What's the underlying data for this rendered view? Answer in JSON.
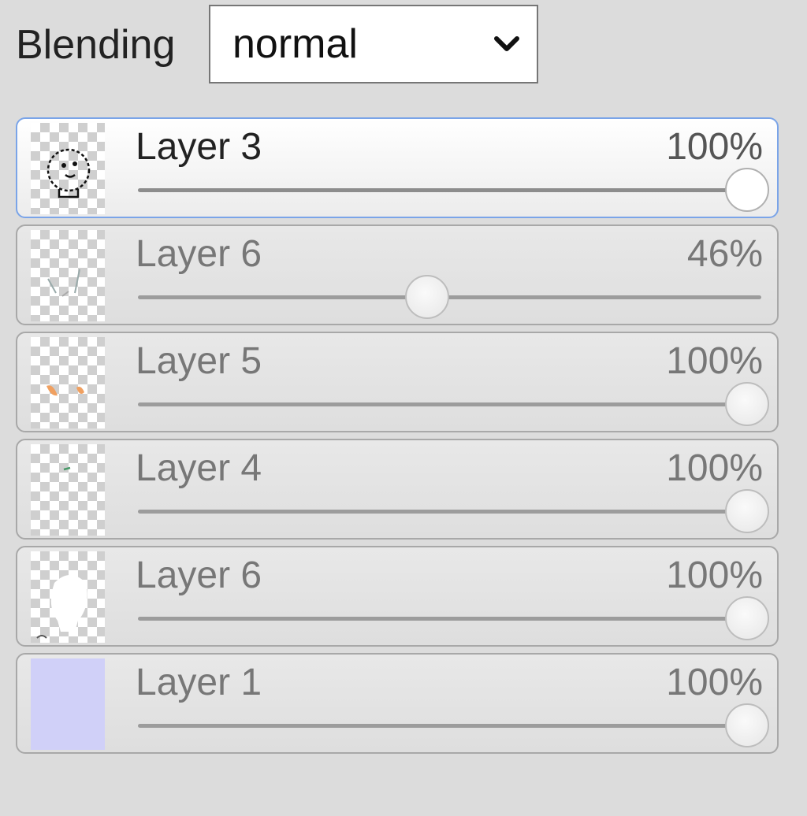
{
  "blending": {
    "label": "Blending",
    "selected": "normal"
  },
  "layers": [
    {
      "name": "Layer 3",
      "opacity": 100,
      "opacity_text": "100%",
      "thumb": "sketch-face-outline",
      "active": true
    },
    {
      "name": "Layer 6",
      "opacity": 46,
      "opacity_text": "46%",
      "thumb": "faint-strokes",
      "active": false
    },
    {
      "name": "Layer 5",
      "opacity": 100,
      "opacity_text": "100%",
      "thumb": "orange-marks",
      "active": false
    },
    {
      "name": "Layer 4",
      "opacity": 100,
      "opacity_text": "100%",
      "thumb": "green-mark",
      "active": false
    },
    {
      "name": "Layer 6",
      "opacity": 100,
      "opacity_text": "100%",
      "thumb": "white-shape",
      "active": false
    },
    {
      "name": "Layer 1",
      "opacity": 100,
      "opacity_text": "100%",
      "thumb": "solid-fill",
      "thumb_color": "#d0d0f8",
      "active": false
    }
  ],
  "colors": {
    "active_border": "#7aa4e8",
    "background": "#dcdcdc"
  }
}
